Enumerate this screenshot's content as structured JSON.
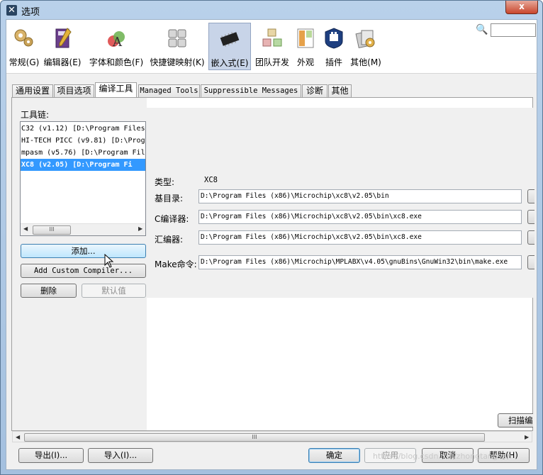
{
  "window": {
    "title": "选项",
    "close_label": "x"
  },
  "categories": [
    {
      "label": "常规(G)",
      "icon": "gears-icon"
    },
    {
      "label": "编辑器(E)",
      "icon": "editor-book-icon"
    },
    {
      "label": "字体和颜色(F)",
      "icon": "font-color-icon"
    },
    {
      "label": "快捷键映射(K)",
      "icon": "keyboard-icon"
    },
    {
      "label": "嵌入式(E)",
      "icon": "chip-icon",
      "selected": true
    },
    {
      "label": "团队开发",
      "icon": "team-cubes-icon"
    },
    {
      "label": "外观",
      "icon": "appearance-icon"
    },
    {
      "label": "插件",
      "icon": "plugin-icon"
    },
    {
      "label": "其他(M)",
      "icon": "misc-icon"
    }
  ],
  "search": {
    "icon": "search-icon",
    "value": ""
  },
  "tabs": [
    {
      "label": "通用设置"
    },
    {
      "label": "项目选项"
    },
    {
      "label": "编译工具",
      "active": true
    },
    {
      "label": "Managed Tools"
    },
    {
      "label": "Suppressible Messages"
    },
    {
      "label": "诊断"
    },
    {
      "label": "其他"
    }
  ],
  "toolchain": {
    "label": "工具链:",
    "items": [
      {
        "text": "C32 (v1.12) [D:\\Program Files"
      },
      {
        "text": "HI-TECH PICC (v9.81) [D:\\Progr"
      },
      {
        "text": "mpasm (v5.76) [D:\\Program File"
      },
      {
        "text": "XC8 (v2.05) [D:\\Program Fi",
        "selected": true
      }
    ],
    "add_label": "添加...",
    "add_custom_label": "Add Custom Compiler...",
    "delete_label": "删除",
    "default_label": "默认值"
  },
  "details": {
    "type_label": "类型:",
    "type_value": "XC8",
    "base_dir_label": "基目录:",
    "base_dir_value": "D:\\Program Files (x86)\\Microchip\\xc8\\v2.05\\bin",
    "c_compiler_label": "C编译器:",
    "c_compiler_value": "D:\\Program Files (x86)\\Microchip\\xc8\\v2.05\\bin\\xc8.exe",
    "assembler_label": "汇编器:",
    "assembler_value": "D:\\Program Files (x86)\\Microchip\\xc8\\v2.05\\bin\\xc8.exe",
    "make_label": "Make命令:",
    "make_value": "D:\\Program Files (x86)\\Microchip\\MPLABX\\v4.05\\gnuBins\\GnuWin32\\bin\\make.exe",
    "scan_label": "扫描编译"
  },
  "footer": {
    "export_label": "导出(I)...",
    "import_label": "导入(I)...",
    "ok_label": "确定",
    "apply_label": "应用",
    "cancel_label": "取消",
    "help_label": "帮助(H)"
  },
  "watermark": "https://blog.csdn.net/zhongtangsan"
}
